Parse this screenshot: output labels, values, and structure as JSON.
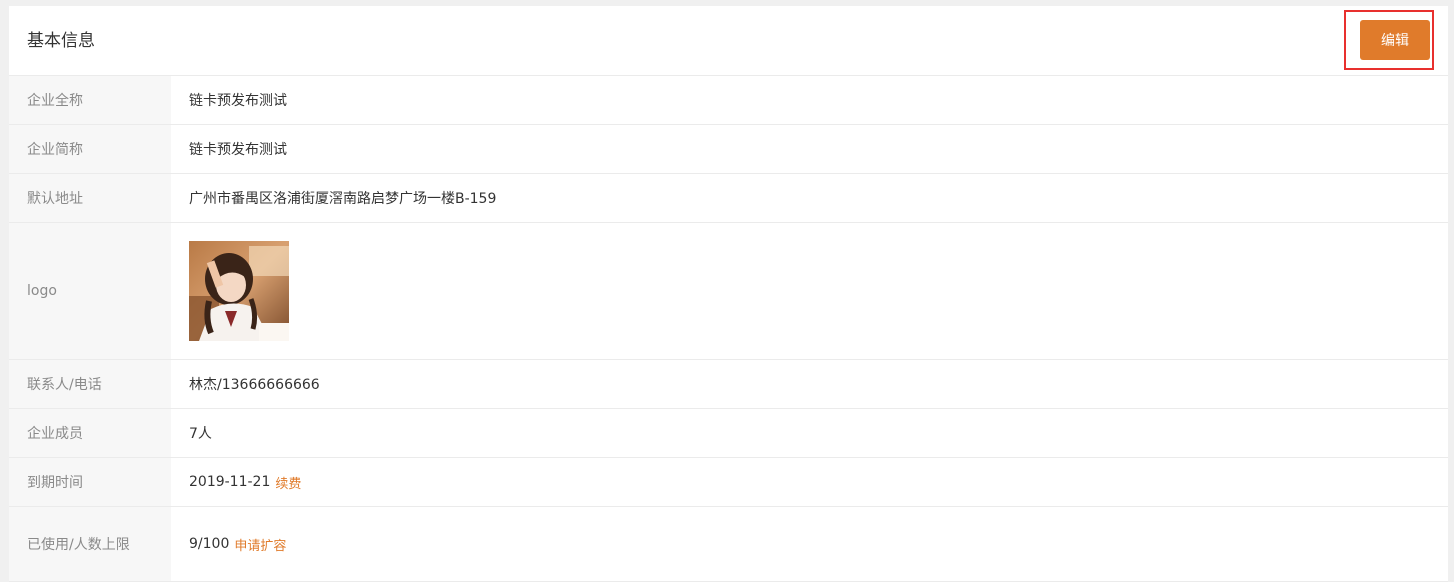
{
  "header": {
    "title": "基本信息",
    "edit_label": "编辑"
  },
  "rows": {
    "full_name": {
      "label": "企业全称",
      "value": "链卡预发布测试"
    },
    "short_name": {
      "label": "企业简称",
      "value": "链卡预发布测试"
    },
    "address": {
      "label": "默认地址",
      "value": "广州市番禺区洛浦街厦滘南路启梦广场一楼B-159"
    },
    "logo": {
      "label": "logo"
    },
    "contact": {
      "label": "联系人/电话",
      "value": "林杰/13666666666"
    },
    "members": {
      "label": "企业成员",
      "value": "7人"
    },
    "expiry": {
      "label": "到期时间",
      "value": "2019-11-21",
      "link": "续费"
    },
    "usage": {
      "label": "已使用/人数上限",
      "value": "9/100",
      "link": "申请扩容"
    }
  },
  "colors": {
    "accent": "#e07b2b",
    "highlight_border": "#e8302e",
    "label_bg": "#f7f7f7"
  }
}
